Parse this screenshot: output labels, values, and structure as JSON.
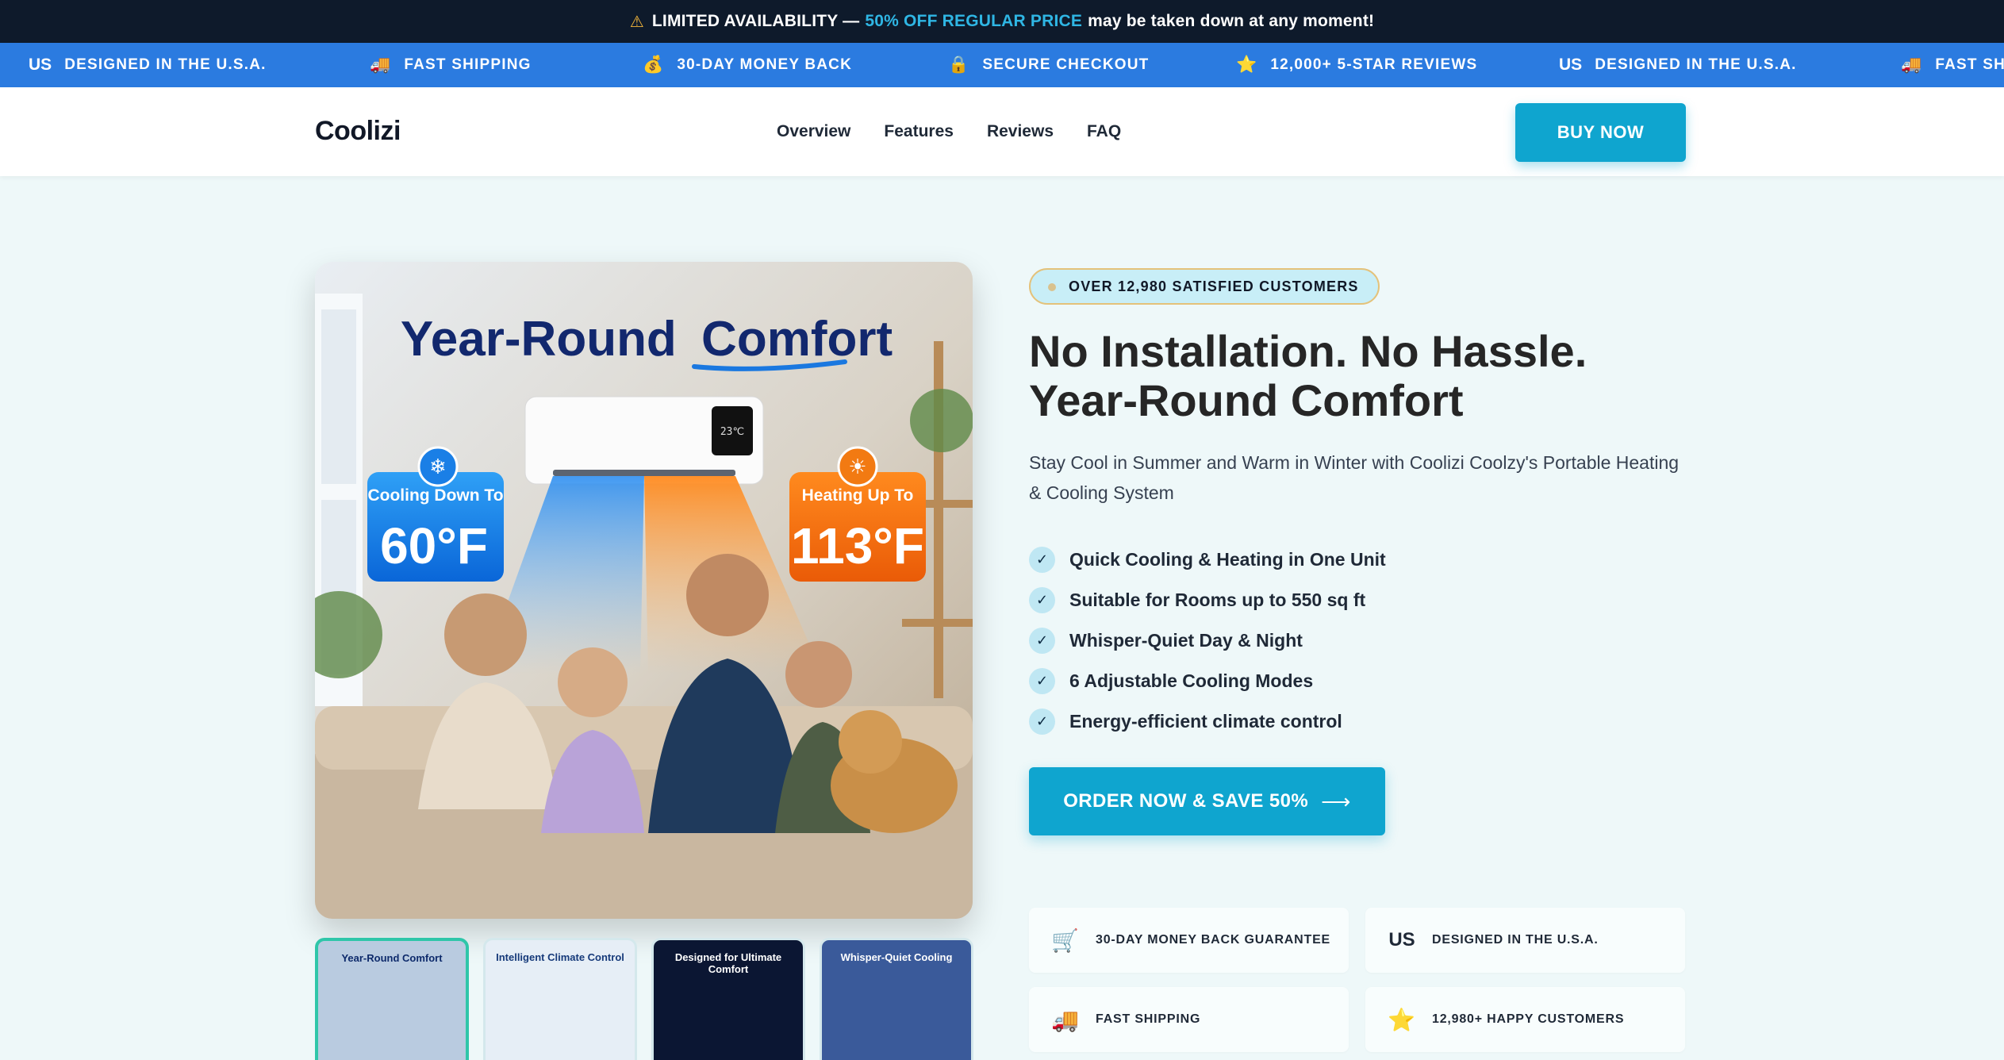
{
  "announcement": {
    "prefix": "LIMITED AVAILABILITY —",
    "highlight": "50% OFF REGULAR PRICE",
    "suffix": "may be taken down at any moment!"
  },
  "marquee": [
    {
      "icon": "us-flag-icon",
      "glyph": "US",
      "label": "DESIGNED IN THE U.S.A."
    },
    {
      "icon": "truck-icon",
      "glyph": "🚚",
      "label": "FAST SHIPPING"
    },
    {
      "icon": "money-bag-icon",
      "glyph": "💰",
      "label": "30-DAY MONEY BACK"
    },
    {
      "icon": "lock-icon",
      "glyph": "🔒",
      "label": "SECURE CHECKOUT"
    },
    {
      "icon": "star-icon",
      "glyph": "⭐",
      "label": "12,000+ 5-STAR REVIEWS"
    },
    {
      "icon": "us-flag-icon",
      "glyph": "US",
      "label": "DESIGNED IN THE U.S.A."
    },
    {
      "icon": "truck-icon",
      "glyph": "🚚",
      "label": "FAST SH"
    }
  ],
  "header": {
    "logo": "Coolizi",
    "nav": [
      "Overview",
      "Features",
      "Reviews",
      "FAQ"
    ],
    "buy_label": "BUY NOW"
  },
  "hero_image": {
    "title_part1": "Year-Round",
    "title_part2": "Comfort",
    "display_temp": "23℃",
    "cool_label": "Cooling Down To",
    "cool_value": "60°F",
    "heat_label": "Heating Up To",
    "heat_value": "113°F"
  },
  "thumbnails": [
    {
      "label": "Year-Round Comfort",
      "bg": "#b9cbe0",
      "fg": "#0d2a6b"
    },
    {
      "label": "Intelligent Climate Control",
      "bg": "#e6eef6",
      "fg": "#163a7a"
    },
    {
      "label": "Designed for Ultimate Comfort",
      "bg": "#0b1633",
      "fg": "#ffffff"
    },
    {
      "label": "Whisper-Quiet Cooling",
      "bg": "#3a5a9a",
      "fg": "#ffffff"
    }
  ],
  "badge": "OVER 12,980 SATISFIED CUSTOMERS",
  "headline": {
    "line1": "No Installation. No Hassle.",
    "line2": "Year-Round Comfort"
  },
  "subheadline": "Stay Cool in Summer and Warm in Winter with Coolizi Coolzy's Portable Heating & Cooling System",
  "features": [
    "Quick Cooling & Heating in One Unit",
    "Suitable for Rooms up to 550 sq ft",
    "Whisper-Quiet Day & Night",
    "6 Adjustable Cooling Modes",
    "Energy-efficient climate control"
  ],
  "order_button": {
    "label": "ORDER NOW & SAVE 50%",
    "arrow": "⟶"
  },
  "trust_cards": [
    {
      "icon": "cart-icon",
      "glyph": "🛒",
      "label": "30-DAY MONEY BACK GUARANTEE"
    },
    {
      "icon": "us-flag-icon",
      "glyph": "US",
      "label": "DESIGNED IN THE U.S.A."
    },
    {
      "icon": "truck-icon",
      "glyph": "🚚",
      "label": "FAST SHIPPING"
    },
    {
      "icon": "star-icon",
      "glyph": "⭐",
      "label": "12,980+ HAPPY CUSTOMERS"
    }
  ],
  "colors": {
    "accent": "#0fa5cf",
    "marquee_bg": "#2b7be0",
    "announce_bg": "#0e1a2b",
    "highlight_text": "#2fb6e4"
  }
}
